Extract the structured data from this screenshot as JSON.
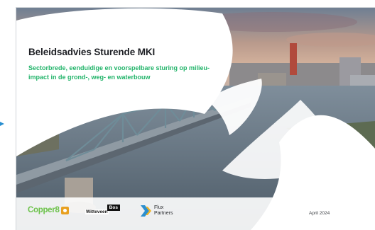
{
  "slide": {
    "title": "Beleidsadvies Sturende MKI",
    "subtitle": "Sectorbrede, eenduidige en voorspelbare sturing op milieu-impact in de grond-, weg- en waterbouw",
    "date": "April 2024"
  },
  "logos": {
    "copper_text": "Copper8",
    "witteveen_text": "Witteveen",
    "bos_text": "Bos",
    "flux_line1": "Flux",
    "flux_line2": "Partners"
  },
  "colors": {
    "accent_green": "#22b46a",
    "title_dark": "#1d1f24"
  },
  "icons": [
    "pointer-arrow-icon",
    "copper8-mark-icon",
    "flux-chevron-icon"
  ]
}
